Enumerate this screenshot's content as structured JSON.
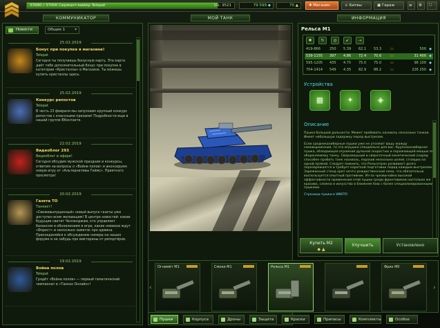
{
  "topbar": {
    "xp_text": "33980 / 37000   Сержант-майор Telepat",
    "xp_fraction": 0.92,
    "gs_text": "GS: 3521",
    "crystals": "79 599",
    "level": "70",
    "buttons": [
      {
        "label": "Магазин",
        "icon": "shop-icon"
      },
      {
        "label": "Битвы",
        "icon": "battles-icon"
      },
      {
        "label": "Гараж",
        "icon": "garage-icon"
      }
    ]
  },
  "panels": {
    "left_title": "КОММУНИКАТОР",
    "center_title": "МОЙ ТАНК",
    "right_title": "ИНФОРМАЦИЯ"
  },
  "communicator": {
    "tab_label": "Новости",
    "filter_value": "Общие 1",
    "news": [
      {
        "date": "25.02.2019",
        "title": "Бонус при покупке в магазине!",
        "author": "Telepat",
        "body": "Сегодня ты получаешь бонусную карту. Эта карта даёт тебе дополнительный бонус при покупке в категории «Кристаллы» в Магазине. Ты можешь купить кристаллы здесь.",
        "thumb_color": "#c8881d"
      },
      {
        "date": "25.02.2019",
        "title": "Конкурс репостов",
        "author": "Telepat",
        "body": "В честь 23 февраля мы запускаем крупный конкурс репостов с классными призами! Подробности ищи в нашей группе ВКонтакте.",
        "thumb_color": "#4a6fb8"
      },
      {
        "date": "22.02.2019",
        "title": "Видеоблог 293",
        "author": "Видеоблог в эфире!",
        "body": "Сегодня обсудим мужской праздник и конкурсы, ответим на вопросы о «Войне полов» и анонсируем новую игру от «Альтернативы Геймс». Приятного просмотра!",
        "thumb_color": "#c3221c"
      },
      {
        "date": "20.02.2019",
        "title": "Газета ТО",
        "author": "Танкист!",
        "body": "«Свежевыпущенный» новый выпуск газеты уже доступен всем желающим! В центре новостей: какие будущие светят Челленджам, кто управляет балансом и обновлением в игре, какие новинки ждут «Форест» и несколько заметок про админа. Присоединяйся к обсуждению номера на наших форуме и не забудь про викторины от репортёров.",
        "thumb_color": "#b79856"
      },
      {
        "date": "19.02.2019",
        "title": "Война полов",
        "author": "Telepat",
        "body": "Грядёт «Война полов» — первый тематический чемпионат в «Танках Онлайн»!",
        "thumb_color": "#2f5a9a"
      }
    ]
  },
  "info": {
    "heading": "Рельса М1",
    "columns_icons": [
      "damage-icon",
      "reload-icon",
      "range-icon",
      "impact-icon",
      "speed-icon"
    ],
    "rows": [
      {
        "c1": "419-866",
        "c2": "250",
        "c3": "5.39",
        "c4": "62.1",
        "c5": "53.3",
        "price": "500",
        "selected": false
      },
      {
        "c1": "539-1155",
        "c2": "397",
        "c3": "4.86",
        "c4": "72.4",
        "c5": "70.6",
        "price": "31 400",
        "selected": true
      },
      {
        "c1": "595-1205",
        "c2": "435",
        "c3": "4.75",
        "c4": "75.0",
        "c5": "75.0",
        "price": "96 100",
        "selected": false
      },
      {
        "c1": "704-1414",
        "c2": "549",
        "c3": "4.35",
        "c4": "82.9",
        "c5": "88.2",
        "price": "226 250",
        "selected": false
      }
    ],
    "devices_title": "Устройства",
    "description_title": "Описание",
    "description": [
      "Пушка большой дальности. Может пробивать насквозь несколько танков. Имеет небольшую задержку перед выстрелом.",
      "Если среднекалиберные пушки уже не утоляют вашу жажду самовыражения, то эта игрушка специально для вас. Крупнокалиберная пушка, обладающая огромной дульной скоростью и поражающей мощью по обороняемому танку. Сверхмощный и сверхточный кинетический снаряд способен пробить танк насквозь, поразив несколько целей, стоящих на одной прямой. Следует помнить, что Рельсотрон развивает долго перезаряжается и требует короткой подготовки перед каждым выстрелом. Заряженный стенд орит нечто рождественской лени, что обязательно воспользуется опытный противник. Из-за чрезвычайно высокой эффективности применения этой пушки среди фронтовиков настолько же красиво, сложно и искусство в ближнем бою с более специализированными пушками.",
      "Страница пушки в WIKITO"
    ],
    "wiki_link": "WIKITO"
  },
  "buy": {
    "buy_label": "Купить М2",
    "upgrade_label": "Улучшить",
    "installed_label": "Установлено"
  },
  "garage": {
    "items": [
      {
        "name": "Огнемёт М1",
        "selected": false
      },
      {
        "name": "Смоки М1",
        "selected": false
      },
      {
        "name": "Рельса М1",
        "selected": true
      },
      {
        "name": "",
        "selected": false
      },
      {
        "name": "Фриз М0",
        "selected": false
      }
    ]
  },
  "bottom_tabs": [
    "Пушки",
    "Корпуса",
    "Дроны",
    "Защита",
    "Краски",
    "Припасы",
    "Комплекты",
    "Особое"
  ],
  "colors": {
    "accent_green": "#5db62c",
    "shop_orange": "#e87a2c",
    "selected_row": "#2f6b1f",
    "section_cyan": "#54d6e6"
  }
}
